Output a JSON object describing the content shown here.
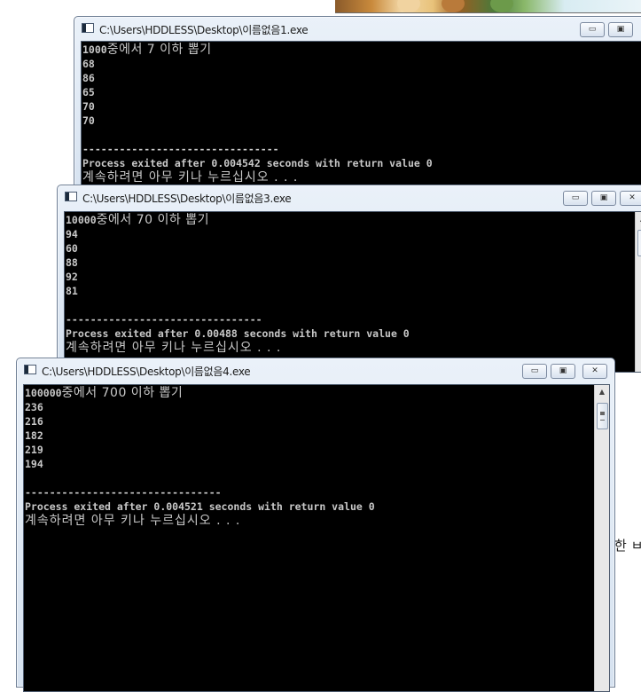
{
  "windows": [
    {
      "title": "C:\\Users\\HDDLESS\\Desktop\\이름없음1.exe",
      "lines": [
        {
          "num": "1000",
          "ko": "중에서 7 이하 뽑기"
        },
        {
          "text": "68"
        },
        {
          "text": "86"
        },
        {
          "text": "65"
        },
        {
          "text": "70"
        },
        {
          "text": "70"
        },
        {
          "text": ""
        },
        {
          "text": "--------------------------------"
        },
        {
          "text": "Process exited after 0.004542 seconds with return value 0"
        },
        {
          "koline": "계속하려면 아무 키나 누르십시오 . . ."
        }
      ]
    },
    {
      "title": "C:\\Users\\HDDLESS\\Desktop\\이름없음3.exe",
      "lines": [
        {
          "num": "10000",
          "ko": "중에서 70 이하 뽑기"
        },
        {
          "text": "94"
        },
        {
          "text": "60"
        },
        {
          "text": "88"
        },
        {
          "text": "92"
        },
        {
          "text": "81"
        },
        {
          "text": ""
        },
        {
          "text": "--------------------------------"
        },
        {
          "text": "Process exited after 0.00488 seconds with return value 0"
        },
        {
          "koline": "계속하려면 아무 키나 누르십시오 . . ."
        }
      ]
    },
    {
      "title": "C:\\Users\\HDDLESS\\Desktop\\이름없음4.exe",
      "lines": [
        {
          "num": "100000",
          "ko": "중에서 700 이하 뽑기"
        },
        {
          "text": "236"
        },
        {
          "text": "216"
        },
        {
          "text": "182"
        },
        {
          "text": "219"
        },
        {
          "text": "194"
        },
        {
          "text": ""
        },
        {
          "text": "--------------------------------"
        },
        {
          "text": "Process exited after 0.004521 seconds with return value 0"
        },
        {
          "koline": "계속하려면 아무 키나 누르십시오 . . ."
        }
      ]
    }
  ],
  "window_controls": {
    "minimize": "▭",
    "maximize": "▣",
    "close": "✕"
  },
  "background_fragment_text": "한 ㅂ",
  "icons": {
    "app": "console-app-icon",
    "scroll_up": "▲",
    "scroll_down": "▼"
  }
}
